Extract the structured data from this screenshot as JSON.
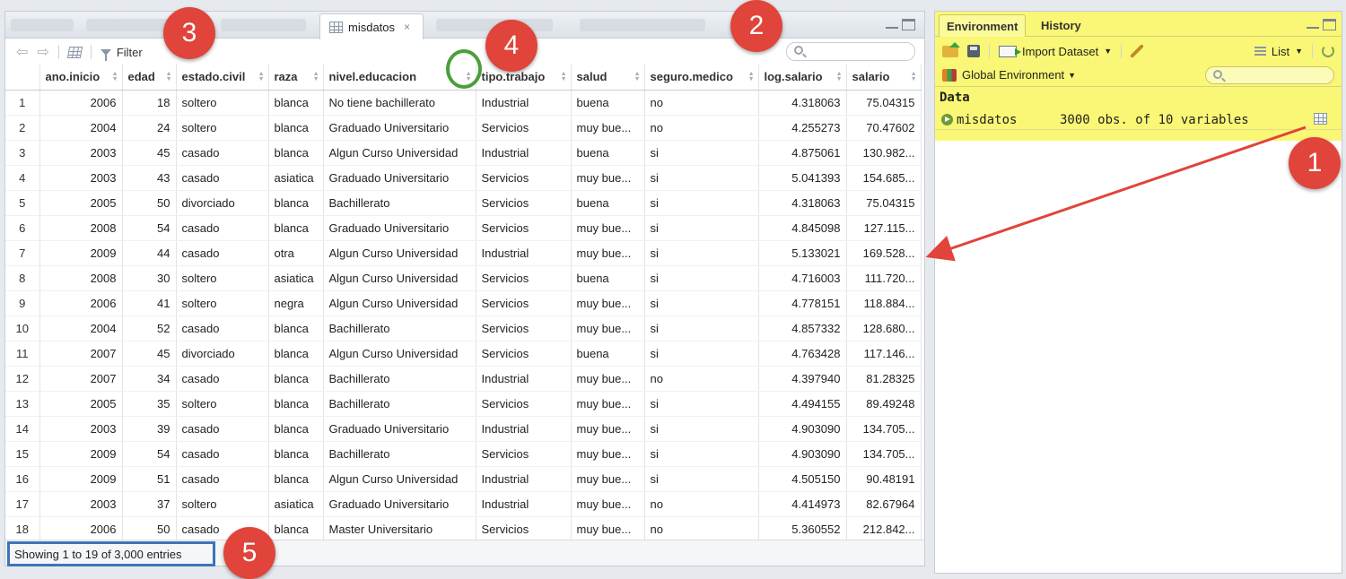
{
  "viewer": {
    "tab_title": "misdatos",
    "tab_close": "×",
    "filter_label": "Filter",
    "columns": [
      "",
      "ano.inicio",
      "edad",
      "estado.civil",
      "raza",
      "nivel.educacion",
      "tipo.trabajo",
      "salud",
      "seguro.medico",
      "log.salario",
      "salario"
    ],
    "rows": [
      [
        "1",
        "2006",
        "18",
        "soltero",
        "blanca",
        "No tiene bachillerato",
        "Industrial",
        "buena",
        "no",
        "4.318063",
        "75.04315"
      ],
      [
        "2",
        "2004",
        "24",
        "soltero",
        "blanca",
        "Graduado Universitario",
        "Servicios",
        "muy bue...",
        "no",
        "4.255273",
        "70.47602"
      ],
      [
        "3",
        "2003",
        "45",
        "casado",
        "blanca",
        "Algun Curso Universidad",
        "Industrial",
        "buena",
        "si",
        "4.875061",
        "130.982..."
      ],
      [
        "4",
        "2003",
        "43",
        "casado",
        "asiatica",
        "Graduado Universitario",
        "Servicios",
        "muy bue...",
        "si",
        "5.041393",
        "154.685..."
      ],
      [
        "5",
        "2005",
        "50",
        "divorciado",
        "blanca",
        "Bachillerato",
        "Servicios",
        "buena",
        "si",
        "4.318063",
        "75.04315"
      ],
      [
        "6",
        "2008",
        "54",
        "casado",
        "blanca",
        "Graduado Universitario",
        "Servicios",
        "muy bue...",
        "si",
        "4.845098",
        "127.115..."
      ],
      [
        "7",
        "2009",
        "44",
        "casado",
        "otra",
        "Algun Curso Universidad",
        "Industrial",
        "muy bue...",
        "si",
        "5.133021",
        "169.528..."
      ],
      [
        "8",
        "2008",
        "30",
        "soltero",
        "asiatica",
        "Algun Curso Universidad",
        "Servicios",
        "buena",
        "si",
        "4.716003",
        "111.720..."
      ],
      [
        "9",
        "2006",
        "41",
        "soltero",
        "negra",
        "Algun Curso Universidad",
        "Servicios",
        "muy bue...",
        "si",
        "4.778151",
        "118.884..."
      ],
      [
        "10",
        "2004",
        "52",
        "casado",
        "blanca",
        "Bachillerato",
        "Servicios",
        "muy bue...",
        "si",
        "4.857332",
        "128.680..."
      ],
      [
        "11",
        "2007",
        "45",
        "divorciado",
        "blanca",
        "Algun Curso Universidad",
        "Servicios",
        "buena",
        "si",
        "4.763428",
        "117.146..."
      ],
      [
        "12",
        "2007",
        "34",
        "casado",
        "blanca",
        "Bachillerato",
        "Industrial",
        "muy bue...",
        "no",
        "4.397940",
        "81.28325"
      ],
      [
        "13",
        "2005",
        "35",
        "soltero",
        "blanca",
        "Bachillerato",
        "Servicios",
        "muy bue...",
        "si",
        "4.494155",
        "89.49248"
      ],
      [
        "14",
        "2003",
        "39",
        "casado",
        "blanca",
        "Graduado Universitario",
        "Industrial",
        "muy bue...",
        "si",
        "4.903090",
        "134.705..."
      ],
      [
        "15",
        "2009",
        "54",
        "casado",
        "blanca",
        "Bachillerato",
        "Servicios",
        "muy bue...",
        "si",
        "4.903090",
        "134.705..."
      ],
      [
        "16",
        "2009",
        "51",
        "casado",
        "blanca",
        "Algun Curso Universidad",
        "Industrial",
        "muy bue...",
        "si",
        "4.505150",
        "90.48191"
      ],
      [
        "17",
        "2003",
        "37",
        "soltero",
        "asiatica",
        "Graduado Universitario",
        "Industrial",
        "muy bue...",
        "no",
        "4.414973",
        "82.67964"
      ],
      [
        "18",
        "2006",
        "50",
        "casado",
        "blanca",
        "Master Universitario",
        "Servicios",
        "muy bue...",
        "no",
        "5.360552",
        "212.842..."
      ]
    ],
    "status": "Showing 1 to 19 of 3,000 entries"
  },
  "environment": {
    "tabs": [
      "Environment",
      "History"
    ],
    "import_label": "Import Dataset",
    "list_label": "List",
    "scope_label": "Global Environment",
    "section_header": "Data",
    "object_name": "misdatos",
    "object_desc": "3000 obs. of 10 variables"
  },
  "annotations": {
    "badges": [
      "1",
      "2",
      "3",
      "4",
      "5"
    ],
    "badge_color": "#e0443a",
    "ring_color": "#4a9f3a",
    "box_color": "#3f74b6",
    "arrow_color": "#e0443a",
    "highlight_color": "#f9f775"
  }
}
